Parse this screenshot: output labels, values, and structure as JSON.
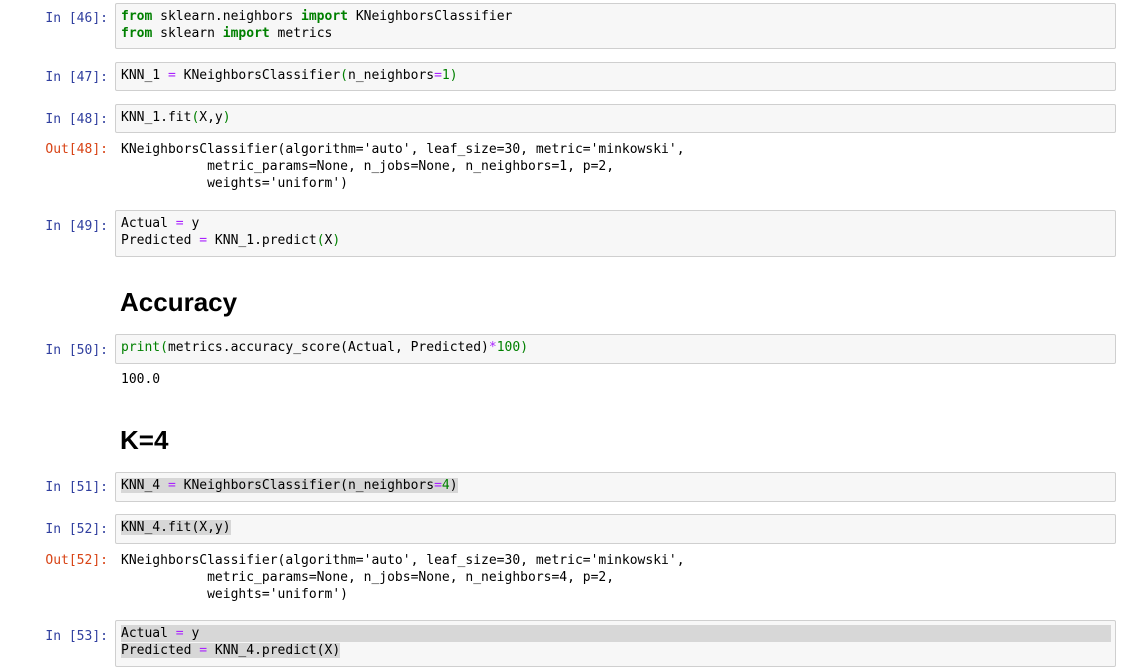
{
  "cells": {
    "c46": {
      "prompt": "In [46]:",
      "line1": {
        "k1": "from",
        "t1": " sklearn.neighbors ",
        "k2": "import",
        "t2": " KNeighborsClassifier"
      },
      "line2": {
        "k1": "from",
        "t1": " sklearn ",
        "k2": "import",
        "t2": " metrics"
      }
    },
    "c47": {
      "prompt": "In [47]:",
      "line1": {
        "a": "KNN_1 ",
        "eq": "=",
        "b": " KNeighborsClassifier",
        "p1": "(",
        "c": "n_neighbors",
        "eq2": "=",
        "n": "1",
        "p2": ")"
      }
    },
    "c48": {
      "prompt": "In [48]:",
      "line1": {
        "a": "KNN_1.fit",
        "p1": "(",
        "b": "X,y",
        "p2": ")"
      }
    },
    "o48": {
      "prompt": "Out[48]:",
      "text": "KNeighborsClassifier(algorithm='auto', leaf_size=30, metric='minkowski',\n           metric_params=None, n_jobs=None, n_neighbors=1, p=2,\n           weights='uniform')"
    },
    "c49": {
      "prompt": "In [49]:",
      "line1": {
        "a": "Actual ",
        "eq": "=",
        "b": " y"
      },
      "line2": {
        "a": "Predicted ",
        "eq": "=",
        "b": " KNN_1.predict",
        "p1": "(",
        "c": "X",
        "p2": ")"
      }
    },
    "h_accuracy": "Accuracy",
    "c50": {
      "prompt": "In [50]:",
      "line1": {
        "fn": "print",
        "p1": "(",
        "a": "metrics.accuracy_score(Actual, Predicted)",
        "op": "*",
        "n": "100",
        "p2": ")"
      }
    },
    "o50": {
      "text": "100.0"
    },
    "h_k4": "K=4",
    "c51": {
      "prompt": "In [51]:",
      "line1": {
        "a": "KNN_4 ",
        "eq": "=",
        "b": " KNeighborsClassifier(n_neighbors",
        "eq2": "=",
        "n": "4",
        "p2": ")"
      }
    },
    "c52": {
      "prompt": "In [52]:",
      "line1": {
        "a": "KNN_4.fit(X,y)"
      }
    },
    "o52": {
      "prompt": "Out[52]:",
      "text": "KNeighborsClassifier(algorithm='auto', leaf_size=30, metric='minkowski',\n           metric_params=None, n_jobs=None, n_neighbors=4, p=2,\n           weights='uniform')"
    },
    "c53": {
      "prompt": "In [53]:",
      "line1": {
        "a": "Actual ",
        "eq": "=",
        "b": " y"
      },
      "line2": {
        "a": "Predicted ",
        "eq": "=",
        "b": " KNN_4.predict(X)"
      }
    }
  }
}
